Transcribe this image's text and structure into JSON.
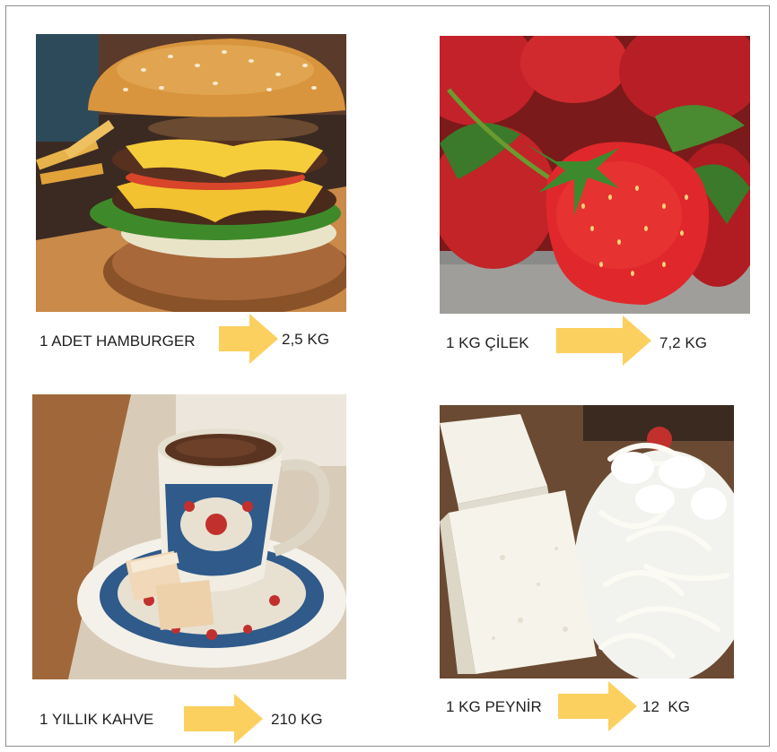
{
  "colors": {
    "arrow": "#fcd05e",
    "border": "#8c8c8c",
    "text": "#1f1f1f"
  },
  "panels": [
    {
      "subject": "hamburger-photo",
      "item_label": "1 ADET HAMBURGER",
      "value_label": "2,5 KG"
    },
    {
      "subject": "strawberry-photo",
      "item_label": "1 KG ÇİLEK",
      "value_label": "7,2 KG"
    },
    {
      "subject": "coffee-photo",
      "item_label": "1 YILLIK KAHVE",
      "value_label": "210 KG"
    },
    {
      "subject": "cheese-photo",
      "item_label": "1 KG PEYNİR",
      "value_label": "12  KG"
    }
  ]
}
